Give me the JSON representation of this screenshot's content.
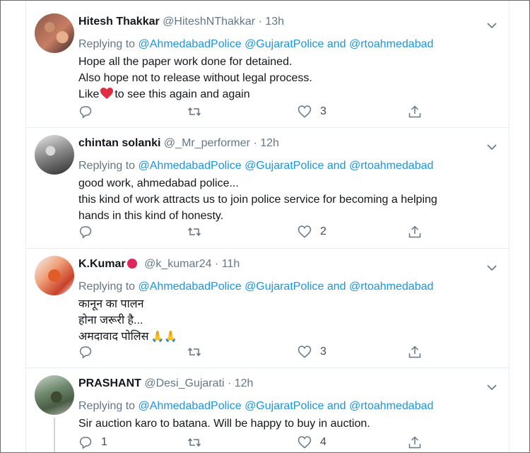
{
  "replying_to_label": "Replying to",
  "mentions": [
    "@AhmedabadPolice",
    "@GujaratPolice",
    "and",
    "@rtoahmedabad"
  ],
  "separator": "·",
  "colors": {
    "link": "#1b95e0",
    "muted": "#657786",
    "text": "#14171a",
    "heart": "#e0245e",
    "border": "#e6ecf0"
  },
  "tweets": [
    {
      "name": "Hitesh Thakkar",
      "handle": "@HiteshNThakkar",
      "time": "13h",
      "avatar_icon": "avatar-photo-man-with-child",
      "lines": [
        "Hope all the paper work done for detained.",
        "Also hope not to release without legal process.",
        "Like",
        "to see this again and again"
      ],
      "counts": {
        "reply": "",
        "retweet": "",
        "like": "3"
      }
    },
    {
      "name": "chintan solanki",
      "handle": "@_Mr_performer",
      "time": "12h",
      "avatar_icon": "avatar-photo-grayscale",
      "lines": [
        "good work, ahmedabad police...",
        "this kind of work attracts us to join police service for becoming a helping",
        "hands in this kind of honesty."
      ],
      "counts": {
        "reply": "",
        "retweet": "",
        "like": "2"
      }
    },
    {
      "name": "K.Kumar",
      "handle": "@k_kumar24",
      "time": "11h",
      "avatar_icon": "avatar-photo-flag",
      "lines": [
        "कानून का पालन",
        "होना जरूरी है...",
        "अमदावाद पोलिस"
      ],
      "counts": {
        "reply": "",
        "retweet": "",
        "like": "3"
      }
    },
    {
      "name": "PRASHANT",
      "handle": "@Desi_Gujarati",
      "time": "12h",
      "avatar_icon": "avatar-photo-outdoor",
      "lines": [
        "Sir auction karo to batana. Will be happy to buy in auction."
      ],
      "counts": {
        "reply": "1",
        "retweet": "",
        "like": "4"
      }
    }
  ]
}
